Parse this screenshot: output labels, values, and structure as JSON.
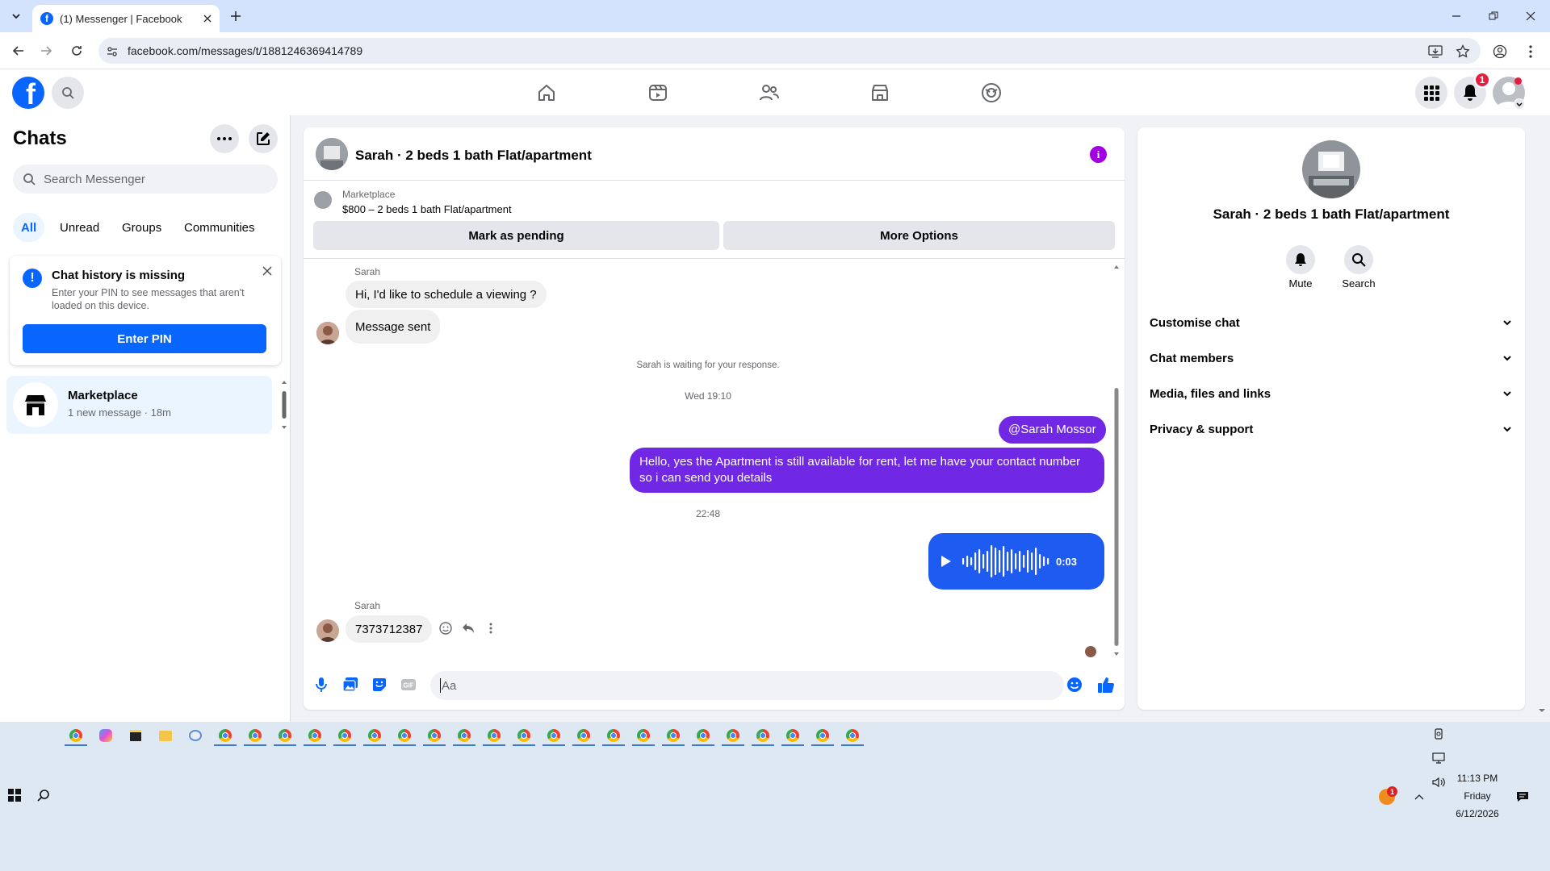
{
  "browser": {
    "tab_title": "(1) Messenger | Facebook",
    "url": "facebook.com/messages/t/1881246369414789"
  },
  "fb": {
    "notification_count": "1"
  },
  "sidebar": {
    "title": "Chats",
    "search_placeholder": "Search Messenger",
    "filters": [
      "All",
      "Unread",
      "Groups",
      "Communities"
    ],
    "history_card": {
      "title": "Chat history is missing",
      "body": "Enter your PIN to see messages that aren't loaded on this device.",
      "button": "Enter PIN"
    },
    "chats": [
      {
        "name": "Marketplace",
        "meta": "1 new message · 18m"
      }
    ]
  },
  "conversation": {
    "title": "Sarah · 2 beds 1 bath Flat/apartment",
    "listing_source": "Marketplace",
    "listing_title": "$800 – 2 beds 1 bath Flat/apartment",
    "btn_pending": "Mark as pending",
    "btn_more": "More Options",
    "messages": {
      "sender1": "Sarah",
      "msg1": "Hi, I'd like to schedule a viewing ?",
      "msg2": "Message sent",
      "waiting": "Sarah is waiting for your response.",
      "time1": "Wed 19:10",
      "mention": "@Sarah Mossor",
      "reply": "Hello, yes the Apartment is still available for rent, let me have your contact number so i can send you details",
      "time2": "22:48",
      "voice_duration": "0:03",
      "sender2": "Sarah",
      "msg3": "7373712387"
    },
    "composer_placeholder": "Aa"
  },
  "info_panel": {
    "title": "Sarah · 2 beds 1 bath Flat/apartment",
    "mute_label": "Mute",
    "search_label": "Search",
    "sections": [
      "Customise chat",
      "Chat members",
      "Media, files and links",
      "Privacy & support"
    ]
  },
  "taskbar": {
    "time": "11:13 PM",
    "day": "Friday",
    "date": "6/12/2026",
    "badge": "1"
  },
  "colors": {
    "fb_blue": "#0866ff",
    "messenger_purple": "#7028e4",
    "voice_blue": "#1e5bf0",
    "badge_red": "#e41e3f"
  }
}
